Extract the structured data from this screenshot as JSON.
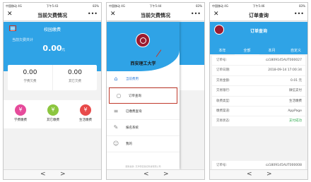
{
  "phone1": {
    "status": {
      "left": "中国移动 4G",
      "time": "下午5:43",
      "right": "83%"
    },
    "nav": {
      "close": "✕",
      "title": "当前欠费情况",
      "more": "•••"
    },
    "banner": {
      "title": "校园缴费",
      "label": "当前欠费共计",
      "amount": "0.00",
      "unit": "元"
    },
    "cards": [
      {
        "value": "0.00",
        "label": "学费欠费"
      },
      {
        "value": "0.00",
        "label": "其它欠费"
      }
    ],
    "services": [
      {
        "label": "学费缴费",
        "icon": "¥",
        "color": "#e64b9b"
      },
      {
        "label": "其它缴费",
        "icon": "¥",
        "color": "#8cc63f"
      },
      {
        "label": "生活缴费",
        "icon": "¥",
        "color": "#e84a4a"
      }
    ],
    "bottom": {
      "back": "<",
      "forward": ">"
    }
  },
  "phone2": {
    "status": {
      "left": "中国移动 4G",
      "time": "下午5:44",
      "right": "83%"
    },
    "nav": {
      "close": "✕",
      "title": "当前欠费情况",
      "more": "•••"
    },
    "university": "西安理工大学",
    "menu": [
      {
        "label": "当前费用",
        "icon": "⌂"
      },
      {
        "label": "订单查询",
        "icon": "○"
      },
      {
        "label": "已缴费查询",
        "icon": "≡"
      },
      {
        "label": "报名系统",
        "icon": "✎"
      },
      {
        "label": "我的",
        "icon": "☺"
      }
    ],
    "footer": "服务提供: 天津伟佳世纪科技有限公司",
    "bottom": {
      "back": "<",
      "forward": ">"
    }
  },
  "phone3": {
    "status": {
      "left": "中国移动 4G",
      "time": "下午5:46",
      "right": "83%"
    },
    "nav": {
      "close": "✕",
      "title": "订单查询",
      "more": "•••"
    },
    "tabs": [
      "本年",
      "全部",
      "本月",
      "自定义"
    ],
    "order": [
      {
        "k": "订单号:",
        "v": "cz1809145AUT000027"
      },
      {
        "k": "订单日期:",
        "v": "2018-09-14 17:00:34"
      },
      {
        "k": "交易金额:",
        "v": "0.01 元"
      },
      {
        "k": "交易银行:",
        "v": "微信支付"
      },
      {
        "k": "收费类型:",
        "v": "生活缴费"
      },
      {
        "k": "缴费渠道:",
        "v": "AppPage"
      },
      {
        "k": "交易状态:",
        "v": "支付成功"
      }
    ],
    "order2": {
      "k": "订单号:",
      "v": "cz1809145AUT000008"
    },
    "bottom": {
      "back": "<",
      "forward": ">"
    }
  }
}
